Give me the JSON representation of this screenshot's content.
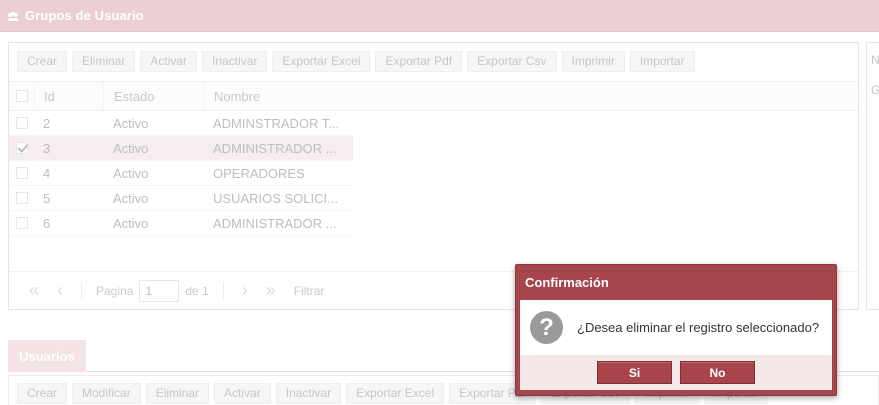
{
  "window": {
    "title": "Grupos de Usuario",
    "icon": "users-group-icon"
  },
  "toolbar": {
    "buttons": [
      "Crear",
      "Eliminar",
      "Activar",
      "Inactivar",
      "Exportar Excel",
      "Exportar Pdf",
      "Exportar Csv",
      "Imprimir",
      "Importar"
    ]
  },
  "grid": {
    "columns": [
      "Id",
      "Estado",
      "Nombre"
    ],
    "rows": [
      {
        "id": "2",
        "estado": "Activo",
        "nombre": "ADMINSTRADOR T...",
        "selected": false
      },
      {
        "id": "3",
        "estado": "Activo",
        "nombre": "ADMINISTRADOR ...",
        "selected": true
      },
      {
        "id": "4",
        "estado": "Activo",
        "nombre": "OPERADORES",
        "selected": false
      },
      {
        "id": "5",
        "estado": "Activo",
        "nombre": "USUARIOS SOLICI...",
        "selected": false
      },
      {
        "id": "6",
        "estado": "Activo",
        "nombre": "ADMINISTRADOR ...",
        "selected": false
      }
    ]
  },
  "pager": {
    "page_label": "Pagina",
    "page_value": "1",
    "of_label": "de 1",
    "filter_label": "Filtrar"
  },
  "side_panel": {
    "label1": "N",
    "label2": "G"
  },
  "tabs": {
    "usuarios": "Usuarios"
  },
  "toolbar2": {
    "buttons": [
      "Crear",
      "Modificar",
      "Eliminar",
      "Activar",
      "Inactivar",
      "Exportar Excel",
      "Exportar Pdf",
      "Exportar Csv",
      "Imprimir",
      "Importar"
    ]
  },
  "dialog": {
    "title": "Confirmación",
    "message": "¿Desea eliminar el registro seleccionado?",
    "icon": "question-icon",
    "yes_label": "Si",
    "no_label": "No"
  },
  "colors": {
    "accent": "#a6454b",
    "titlebar": "#eccfd2",
    "selected_row": "#eedfe1"
  }
}
